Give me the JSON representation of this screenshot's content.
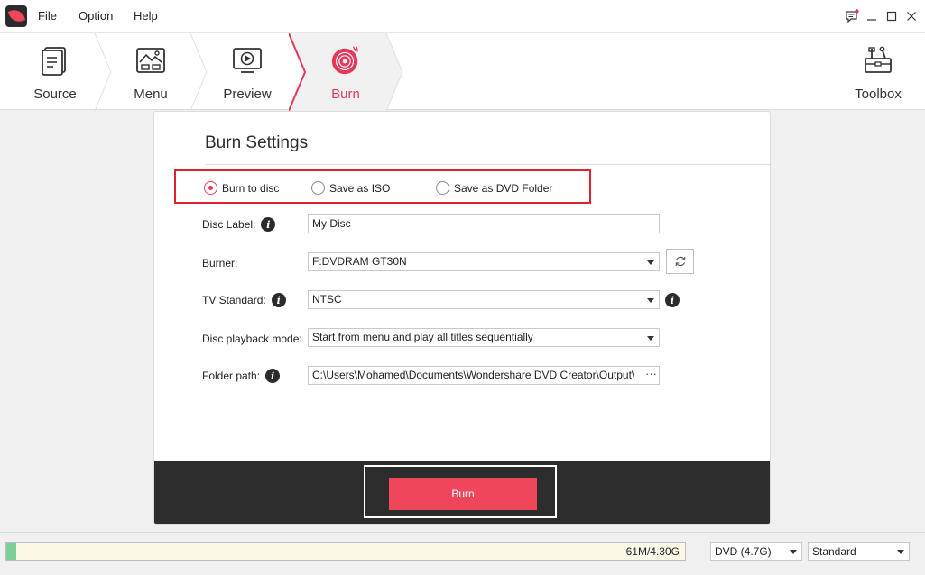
{
  "menu": {
    "file": "File",
    "option": "Option",
    "help": "Help"
  },
  "steps": {
    "source": "Source",
    "menu": "Menu",
    "preview": "Preview",
    "burn": "Burn",
    "toolbox": "Toolbox",
    "active": "burn"
  },
  "colors": {
    "accent": "#e8385a",
    "burn_button": "#f0465b",
    "highlight_box": "#e0202f",
    "footer": "#2d2d2d",
    "capacity_fill": "#7dcf9a"
  },
  "burn_settings": {
    "title": "Burn Settings",
    "output_options": [
      {
        "label": "Burn to disc",
        "checked": true
      },
      {
        "label": "Save as ISO",
        "checked": false
      },
      {
        "label": "Save as DVD Folder",
        "checked": false
      }
    ],
    "disc_label": {
      "label": "Disc Label:",
      "value": "My Disc"
    },
    "burner": {
      "label": "Burner:",
      "value": "F:DVDRAM GT30N"
    },
    "tv_standard": {
      "label": "TV Standard:",
      "value": "NTSC"
    },
    "playback_mode": {
      "label": "Disc playback mode:",
      "value": "Start from menu and play all titles sequentially"
    },
    "folder_path": {
      "label": "Folder path:",
      "value": "C:\\Users\\Mohamed\\Documents\\Wondershare DVD Creator\\Output\\",
      "more": "···"
    },
    "burn_button": "Burn"
  },
  "status": {
    "capacity_text": "61M/4.30G",
    "capacity_fraction": 0.014,
    "disc_type": "DVD (4.7G)",
    "quality": "Standard"
  }
}
